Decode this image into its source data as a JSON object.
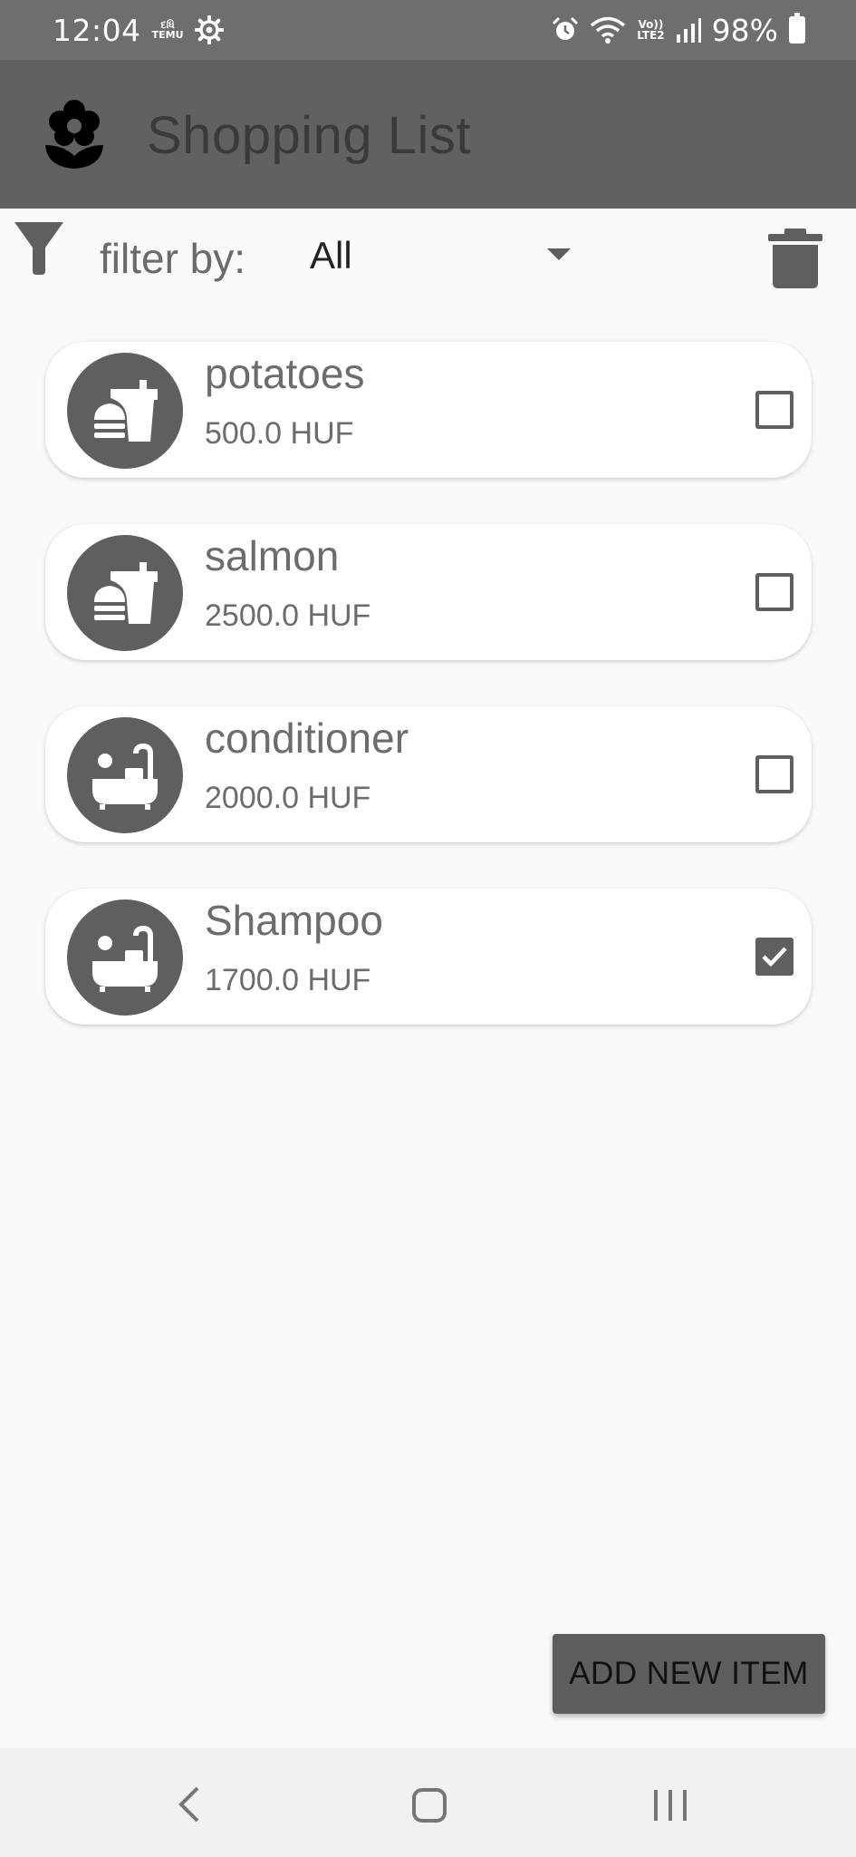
{
  "status_bar": {
    "time": "12:04",
    "temu_badge_line1": "દધિ",
    "temu_badge_line2": "TEMU",
    "lte_line1": "Vo))",
    "lte_line2": "LTE2",
    "battery": "98%",
    "icons": [
      "temu-icon",
      "settings-gear-icon",
      "alarm-icon",
      "wifi-icon",
      "volte-icon",
      "signal-icon",
      "battery-icon"
    ]
  },
  "app_bar": {
    "title": "Shopping List",
    "logo_icon": "flower-icon"
  },
  "filter": {
    "label": "filter by:",
    "selected": "All",
    "filter_icon": "funnel-icon",
    "delete_icon": "trash-icon"
  },
  "items": [
    {
      "name": "potatoes",
      "price": "500.0 HUF",
      "category_icon": "fastfood-icon",
      "checked": false
    },
    {
      "name": "salmon",
      "price": "2500.0 HUF",
      "category_icon": "fastfood-icon",
      "checked": false
    },
    {
      "name": "conditioner",
      "price": "2000.0 HUF",
      "category_icon": "bathtub-icon",
      "checked": false
    },
    {
      "name": "Shampoo",
      "price": "1700.0 HUF",
      "category_icon": "bathtub-icon",
      "checked": true
    }
  ],
  "actions": {
    "add_new_item": "ADD NEW ITEM"
  },
  "nav_bar": {
    "icons": [
      "back-icon",
      "home-icon",
      "recents-icon"
    ]
  },
  "colors": {
    "status_bar": "#6e6e6e",
    "app_bar": "#616161",
    "background": "#f9f9f9",
    "accent": "#5f5f5f"
  }
}
